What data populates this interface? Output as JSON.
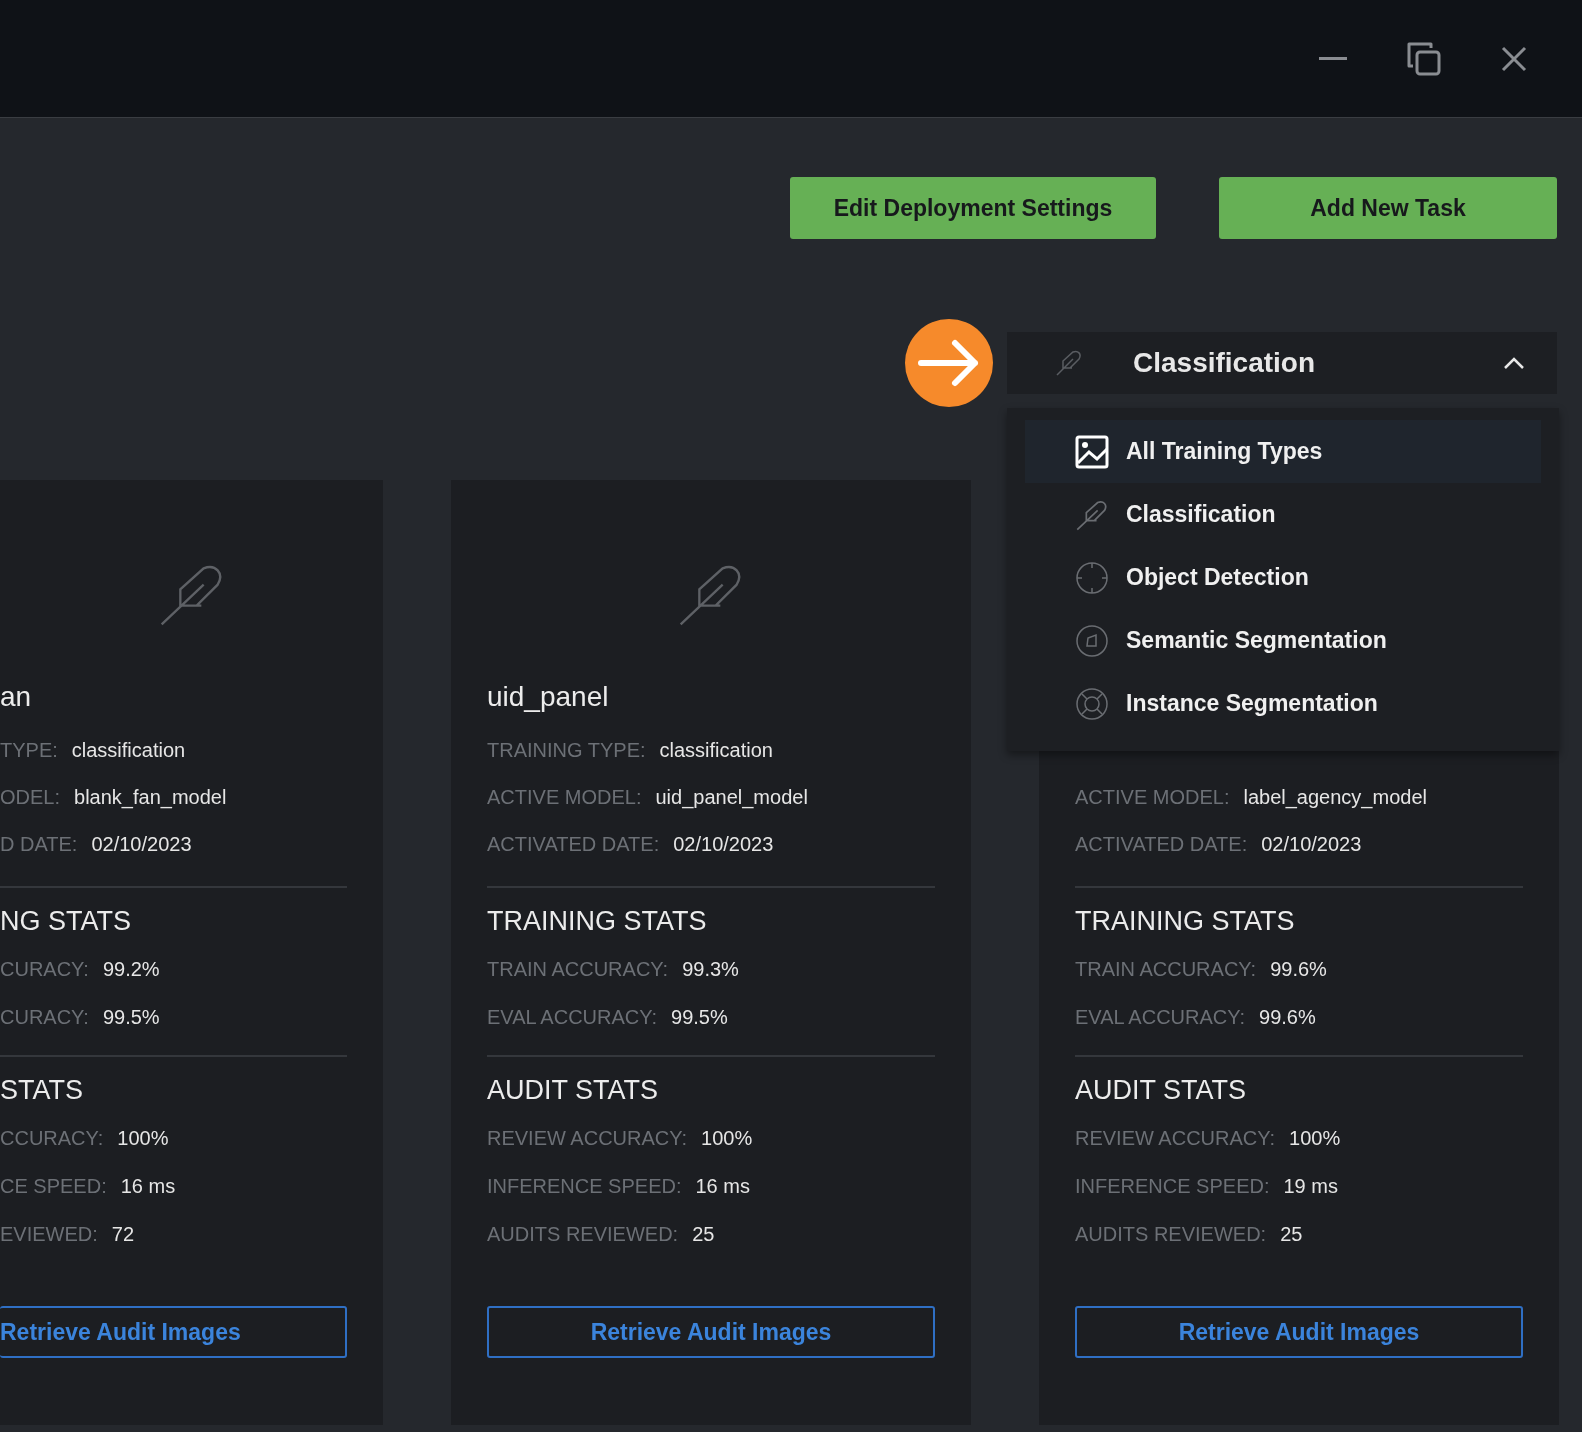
{
  "actions": [
    "Edit Deployment Settings",
    "Add New Task"
  ],
  "filter": {
    "label": "Classification",
    "expanded": true,
    "options": [
      {
        "label": "All Training Types",
        "kind": "image",
        "highlighted": true
      },
      {
        "label": "Classification",
        "kind": "feather",
        "highlighted": false
      },
      {
        "label": "Object Detection",
        "kind": "crosshair",
        "highlighted": false
      },
      {
        "label": "Semantic Segmentation",
        "kind": "segment",
        "highlighted": false
      },
      {
        "label": "Instance Segmentation",
        "kind": "instance",
        "highlighted": false
      }
    ]
  },
  "cards": [
    {
      "title": "an",
      "fields": [
        {
          "label": "TYPE:",
          "value": "classification"
        },
        {
          "label": "ODEL:",
          "value": "blank_fan_model"
        },
        {
          "label": "D DATE:",
          "value": "02/10/2023"
        }
      ],
      "sections": [
        {
          "heading": "NG STATS",
          "fields": [
            {
              "label": "CURACY:",
              "value": "99.2%"
            },
            {
              "label": "CURACY:",
              "value": "99.5%"
            }
          ]
        },
        {
          "heading": "STATS",
          "fields": [
            {
              "label": "CCURACY:",
              "value": "100%"
            },
            {
              "label": "CE SPEED:",
              "value": "16 ms"
            },
            {
              "label": "EVIEWED:",
              "value": "72"
            }
          ]
        }
      ],
      "button": "Retrieve Audit Images"
    },
    {
      "title": "uid_panel",
      "fields": [
        {
          "label": "TRAINING TYPE:",
          "value": "classification"
        },
        {
          "label": "ACTIVE MODEL:",
          "value": "uid_panel_model"
        },
        {
          "label": "ACTIVATED DATE:",
          "value": "02/10/2023"
        }
      ],
      "sections": [
        {
          "heading": "TRAINING STATS",
          "fields": [
            {
              "label": "TRAIN ACCURACY:",
              "value": "99.3%"
            },
            {
              "label": "EVAL ACCURACY:",
              "value": "99.5%"
            }
          ]
        },
        {
          "heading": "AUDIT STATS",
          "fields": [
            {
              "label": "REVIEW ACCURACY:",
              "value": "100%"
            },
            {
              "label": "INFERENCE SPEED:",
              "value": "16 ms"
            },
            {
              "label": "AUDITS REVIEWED:",
              "value": "25"
            }
          ]
        }
      ],
      "button": "Retrieve Audit Images"
    },
    {
      "fields": [
        {
          "label": "ACTIVE MODEL:",
          "value": "label_agency_model"
        },
        {
          "label": "ACTIVATED DATE:",
          "value": "02/10/2023"
        }
      ],
      "sections": [
        {
          "heading": "TRAINING STATS",
          "fields": [
            {
              "label": "TRAIN ACCURACY:",
              "value": "99.6%"
            },
            {
              "label": "EVAL ACCURACY:",
              "value": "99.6%"
            }
          ]
        },
        {
          "heading": "AUDIT STATS",
          "fields": [
            {
              "label": "REVIEW ACCURACY:",
              "value": "100%"
            },
            {
              "label": "INFERENCE SPEED:",
              "value": "19 ms"
            },
            {
              "label": "AUDITS REVIEWED:",
              "value": "25"
            }
          ]
        }
      ],
      "button": "Retrieve Audit Images"
    }
  ]
}
